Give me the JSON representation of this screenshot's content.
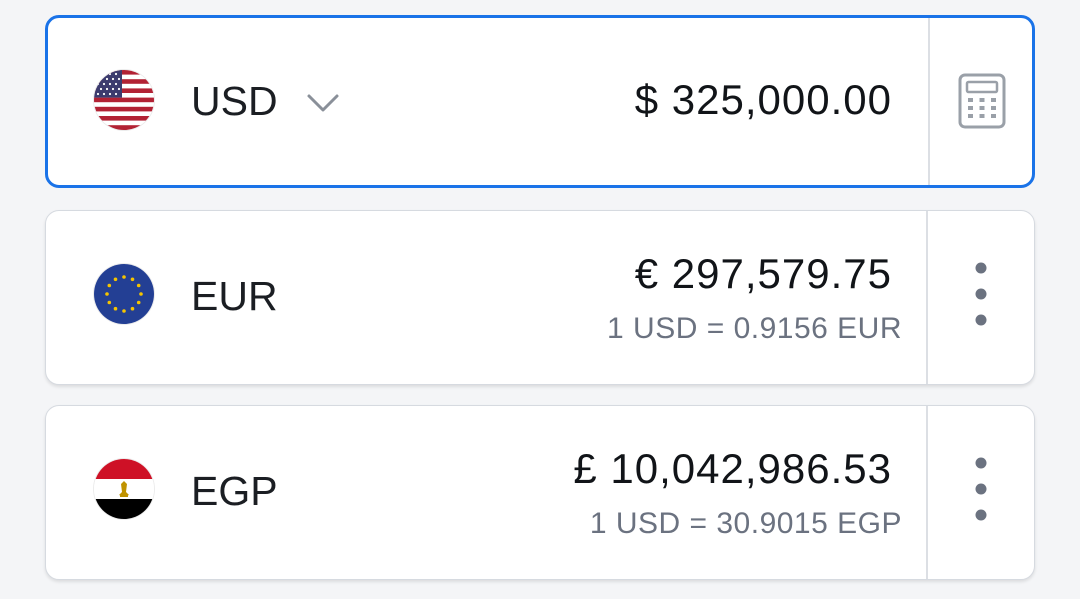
{
  "base": {
    "code": "USD",
    "flag": "us-flag",
    "amount": "$ 325,000.00",
    "dropdown_icon": "chevron-down-icon",
    "calculator_icon": "calculator-icon"
  },
  "conversions": [
    {
      "code": "EUR",
      "flag": "eu-flag",
      "amount": "€ 297,579.75",
      "rate": "1 USD = 0.9156 EUR",
      "menu_icon": "more-vertical-icon"
    },
    {
      "code": "EGP",
      "flag": "egypt-flag",
      "amount": "£ 10,042,986.53",
      "rate": "1 USD = 30.9015 EGP",
      "menu_icon": "more-vertical-icon"
    }
  ],
  "colors": {
    "active_border": "#1a73e8",
    "primary_text": "#111418",
    "secondary_text": "#6b7280",
    "icon": "#9aa0a8"
  }
}
